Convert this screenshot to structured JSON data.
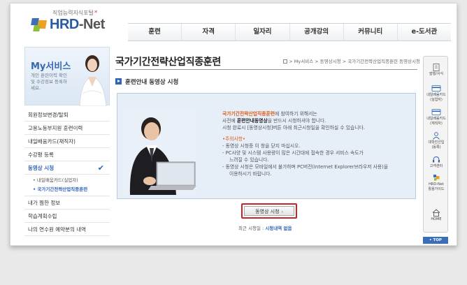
{
  "header": {
    "logo_subtitle": "직업능력지식포털",
    "logo_star": "*",
    "logo_text_main": "HRD",
    "logo_text_suffix": "-Net",
    "nav": [
      "훈련",
      "자격",
      "일자리",
      "공개강의",
      "커뮤니티",
      "e-도서관"
    ]
  },
  "sidebar": {
    "title": "My서비스",
    "description": "개인 훈련이력 확인 및 수강정보 등록하세요.",
    "items": [
      {
        "label": "회원정보변경/탈퇴"
      },
      {
        "label": "고용노동부지원 훈련이력"
      },
      {
        "label": "내일배움카드(재직자)"
      },
      {
        "label": "수강평 등록"
      },
      {
        "label": "동영상 시청",
        "active": true
      }
    ],
    "subitems": [
      {
        "label": "내일배움카드(실업자)"
      },
      {
        "label": "국가기간전략산업직종훈련",
        "active": true
      }
    ],
    "items_after": [
      {
        "label": "내가 찜한 정보"
      },
      {
        "label": "학습계획수립"
      },
      {
        "label": "나의 연수원 예약분의 내역"
      }
    ],
    "check_glyph": "✔"
  },
  "main": {
    "page_title": "국가기간전략산업직종훈련",
    "breadcrumb": "> My서비스 > 동영상시청 > 국가기간전략산업직종훈련 동영상시청",
    "section_title": "훈련안내 동영상 시청",
    "intro": {
      "line1_highlight": "국가기간전략산업직종훈련",
      "line1_rest": "에 참여하기 위해서는",
      "line2_pre": "사전에 ",
      "line2_bold": "훈련안내동영상",
      "line2_post": "을 반드시 시청하셔야 합니다.",
      "line3": "시청 완료시 [동영상시청]버튼 아래 최근시청일을 확인하실 수 있습니다."
    },
    "notice_title": "•주의사항•",
    "notices": [
      "- 동영상 시청중 이 창을 닫지 마십시오.",
      "- PC사양 및 시스템 사용량이 많은 시간대에 접속한 경우 서비스 속도가",
      "느려질 수 있습니다.",
      "- 동영상 시청은 모바일에서 불가하며 PC버전(Internet Explorer브라우저 사용)을",
      "이용하시기 바랍니다."
    ],
    "watch_button": "동영상 시청",
    "watch_arrow": "›",
    "recent_label": "최근 시청일 : ",
    "recent_value": "시청내역 없음"
  },
  "quickbar": {
    "items": [
      {
        "label": "발행/서식",
        "icon": "document-icon"
      },
      {
        "label": "내일배움카드",
        "label2": "(실업자)",
        "icon": "card-icon"
      },
      {
        "label": "내일배움카드",
        "label2": "(재직자)",
        "icon": "card-icon"
      },
      {
        "label": "대학진선입",
        "label2": "(등록)",
        "icon": "person-icon"
      },
      {
        "label": "고객센터",
        "icon": "headset-icon"
      },
      {
        "label": "HRD-Net",
        "label2": "활용가이드",
        "icon": "hrd-logo-icon"
      },
      {
        "label": "HOME",
        "icon": "home-icon"
      }
    ],
    "top_label": "• TOP"
  },
  "colors": {
    "accent_blue": "#2f63b6",
    "highlight_orange": "#e05a1a",
    "button_outline_red": "#c8222a",
    "content_box_bg": "#e6eef8"
  }
}
